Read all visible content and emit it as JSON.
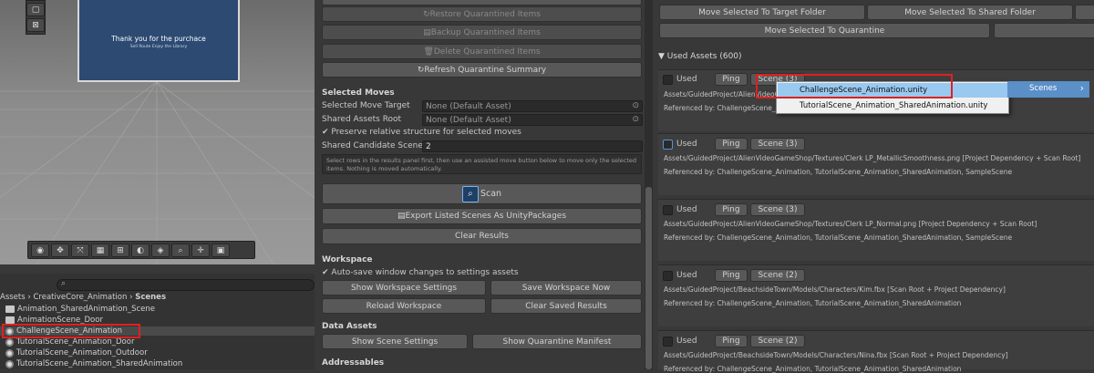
{
  "scene_view": {
    "thanks_line1": "Thank you for the purchace",
    "thanks_line2": "Sell Route Enjoy the Library",
    "tool_icons": [
      "compass-icon",
      "move-icon",
      "scale-icon",
      "grid-icon",
      "snap-icon",
      "circle-icon",
      "eye-icon",
      "zoom-icon",
      "transform-icon",
      "camera-icon"
    ]
  },
  "project": {
    "search_placeholder": "",
    "breadcrumb": [
      "Assets",
      "CreativeCore_Animation",
      "Scenes"
    ],
    "items": [
      {
        "label": "Animation_SharedAnimation_Scene",
        "type": "folder"
      },
      {
        "label": "AnimationScene_Door",
        "type": "folder"
      },
      {
        "label": "ChallengeScene_Animation",
        "type": "scene"
      },
      {
        "label": "TutorialScene_Animation_Door",
        "type": "scene"
      },
      {
        "label": "TutorialScene_Animation_Outdoor",
        "type": "scene"
      },
      {
        "label": "TutorialScene_Animation_SharedAnimation",
        "type": "scene"
      }
    ]
  },
  "middle": {
    "restore": "Restore Quarantined Items",
    "backup": "Backup Quarantined Items",
    "delete": "Delete Quarantined Items",
    "refresh": "Refresh Quarantine Summary",
    "selected_moves": "Selected Moves",
    "move_target_label": "Selected Move Target",
    "move_target_value": "None (Default Asset)",
    "shared_root_label": "Shared Assets Root",
    "shared_root_value": "None (Default Asset)",
    "preserve": "Preserve relative structure for selected moves",
    "shared_candidate_label": "Shared Candidate Scene C",
    "shared_candidate_value": "2",
    "help": "Select rows in the results panel first, then use an assisted move button below to move only the selected items. Nothing is moved automatically.",
    "scan": "Scan",
    "export": "Export Listed Scenes As UnityPackages",
    "clear": "Clear Results",
    "workspace": "Workspace",
    "autosave": "Auto-save window changes to settings assets",
    "show_ws": "Show Workspace Settings",
    "save_ws": "Save Workspace Now",
    "reload_ws": "Reload Workspace",
    "clear_saved": "Clear Saved Results",
    "data_assets": "Data Assets",
    "show_scene": "Show Scene Settings",
    "show_quarantine": "Show Quarantine Manifest",
    "addressables": "Addressables"
  },
  "right": {
    "move_target": "Move Selected To Target Folder",
    "move_shared": "Move Selected To Shared Folder",
    "move_quarantine": "Move Selected To Quarantine",
    "used_header": "Used Assets (600)",
    "assets": [
      {
        "used": "Used",
        "ping": "Ping",
        "scene": "Scene (3)",
        "path": "Assets/GuidedProject/AlienVideoGa",
        "ref": "Referenced by: ChallengeScene_Animation"
      },
      {
        "used": "Used",
        "ping": "Ping",
        "scene": "Scene (3)",
        "path": "Assets/GuidedProject/AlienVideoGameShop/Textures/Clerk LP_MetallicSmoothness.png    [Project Dependency + Scan Root]",
        "ref": "Referenced by: ChallengeScene_Animation, TutorialScene_Animation_SharedAnimation, SampleScene"
      },
      {
        "used": "Used",
        "ping": "Ping",
        "scene": "Scene (3)",
        "path": "Assets/GuidedProject/AlienVideoGameShop/Textures/Clerk LP_Normal.png    [Project Dependency + Scan Root]",
        "ref": "Referenced by: ChallengeScene_Animation, TutorialScene_Animation_SharedAnimation, SampleScene"
      },
      {
        "used": "Used",
        "ping": "Ping",
        "scene": "Scene (2)",
        "path": "Assets/GuidedProject/BeachsideTown/Models/Characters/Kim.fbx    [Scan Root + Project Dependency]",
        "ref": "Referenced by: ChallengeScene_Animation, TutorialScene_Animation_SharedAnimation"
      },
      {
        "used": "Used",
        "ping": "Ping",
        "scene": "Scene (2)",
        "path": "Assets/GuidedProject/BeachsideTown/Models/Characters/Nina.fbx    [Scan Root + Project Dependency]",
        "ref": "Referenced by: ChallengeScene_Animation, TutorialScene_Animation_SharedAnimation"
      }
    ],
    "menu": {
      "items": [
        "ChallengeScene_Animation.unity",
        "TutorialScene_Animation_SharedAnimation.unity"
      ],
      "submenu": "Scenes",
      "arrow": "›"
    }
  },
  "colors": {
    "highlight": "#4a90d9",
    "redbox": "#e02020"
  }
}
